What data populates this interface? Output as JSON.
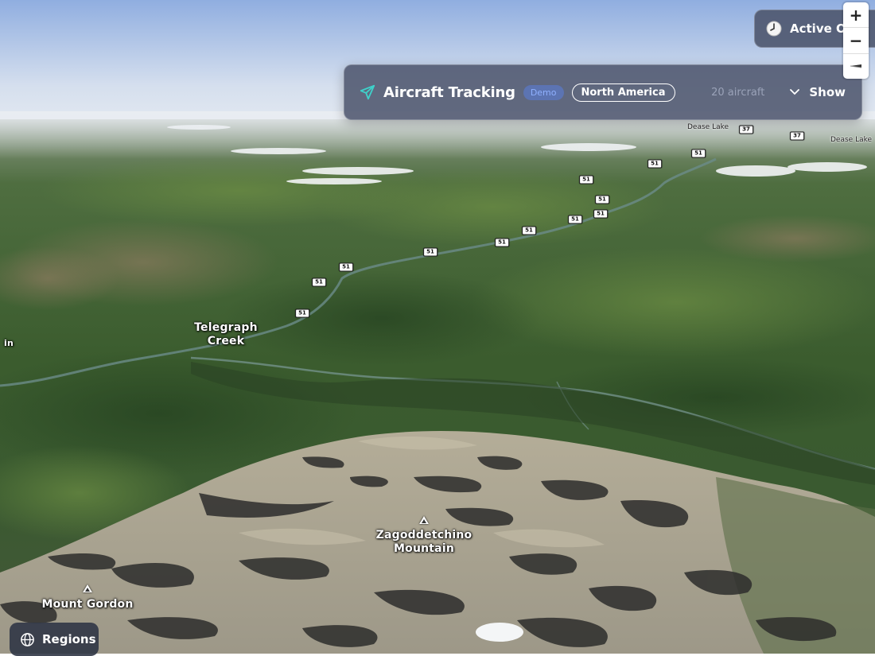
{
  "map": {
    "place_labels": [
      {
        "id": "telegraph-creek",
        "text": "Telegraph\nCreek"
      },
      {
        "id": "zagoddetchino",
        "text": "Zagoddetchino\nMountain"
      },
      {
        "id": "mount-gordon",
        "text": "Mount Gordon"
      },
      {
        "id": "left-edge",
        "text": "in"
      }
    ],
    "small_labels": [
      {
        "id": "dease-lake-1",
        "text": "Dease Lake"
      },
      {
        "id": "dease-lake-2",
        "text": "Dease Lake"
      }
    ],
    "route_shields": [
      "51",
      "51",
      "51",
      "51",
      "51",
      "51",
      "51",
      "51",
      "51",
      "51",
      "51",
      "51",
      "37",
      "37"
    ]
  },
  "tracking_panel": {
    "title": "Aircraft Tracking",
    "badge": "Demo",
    "region": "North America",
    "count": "20 aircraft",
    "toggle_label": "Show",
    "icon": "plane-icon"
  },
  "active_button": {
    "label": "Active On",
    "icon": "clock-icon"
  },
  "zoom_controls": {
    "zoom_in": "+",
    "zoom_out": "−",
    "compass": "compass-icon"
  },
  "regions_button": {
    "label": "Regions",
    "icon": "globe-icon"
  },
  "colors": {
    "panel_bg": "#4e566e",
    "demo_badge": "#5a7ddc",
    "plane_icon": "#3fd0c9",
    "forest": "#3c5a31",
    "sky": "#9fb6e0"
  }
}
